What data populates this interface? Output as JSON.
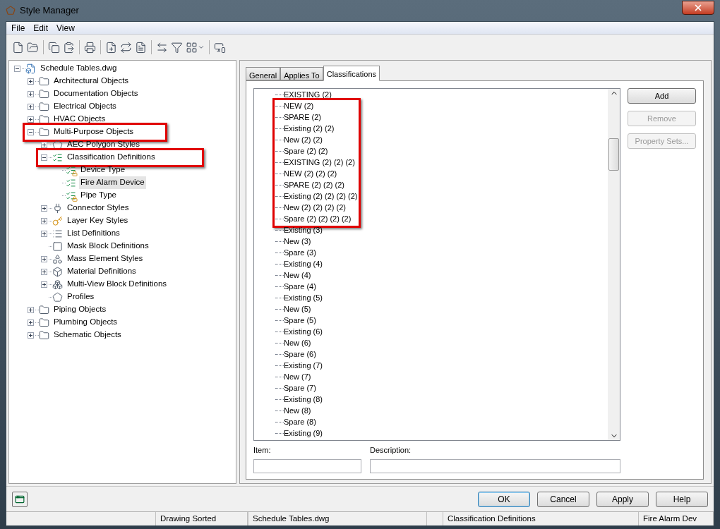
{
  "window": {
    "title": "Style Manager"
  },
  "menu": [
    "File",
    "Edit",
    "View"
  ],
  "toolbar": [
    {
      "kind": "new"
    },
    {
      "kind": "open"
    },
    {
      "kind": "sep"
    },
    {
      "kind": "copy"
    },
    {
      "kind": "paste"
    },
    {
      "kind": "sep"
    },
    {
      "kind": "print"
    },
    {
      "kind": "sep"
    },
    {
      "kind": "newstyle"
    },
    {
      "kind": "purge"
    },
    {
      "kind": "edit"
    },
    {
      "kind": "sep"
    },
    {
      "kind": "sync"
    },
    {
      "kind": "filter"
    },
    {
      "kind": "view"
    },
    {
      "kind": "sep"
    },
    {
      "kind": "toggle"
    }
  ],
  "tree": [
    {
      "label": "Schedule Tables.dwg",
      "kind": "drawing",
      "expanded": true,
      "selected": false,
      "highlighted": false,
      "children": [
        {
          "label": "Architectural Objects",
          "kind": "folder",
          "expanded": false,
          "selected": false,
          "highlighted": false
        },
        {
          "label": "Documentation Objects",
          "kind": "folder",
          "expanded": false,
          "selected": false,
          "highlighted": false
        },
        {
          "label": "Electrical Objects",
          "kind": "folder",
          "expanded": false,
          "selected": false,
          "highlighted": false
        },
        {
          "label": "HVAC Objects",
          "kind": "folder",
          "expanded": false,
          "selected": false,
          "highlighted": false
        },
        {
          "label": "Multi-Purpose Objects",
          "kind": "folder",
          "expanded": true,
          "selected": false,
          "highlighted": true,
          "children": [
            {
              "label": "AEC Polygon Styles",
              "kind": "polygon",
              "expanded": false,
              "selected": false,
              "highlighted": false
            },
            {
              "label": "Classification Definitions",
              "kind": "classification",
              "expanded": true,
              "selected": false,
              "highlighted": true,
              "children": [
                {
                  "label": "Device Type",
                  "kind": "classlock",
                  "selected": false,
                  "highlighted": false
                },
                {
                  "label": "Fire Alarm Device",
                  "kind": "classification",
                  "selected": true,
                  "highlighted": false
                },
                {
                  "label": "Pipe Type",
                  "kind": "classlock",
                  "selected": false,
                  "highlighted": false
                }
              ]
            },
            {
              "label": "Connector Styles",
              "kind": "connector",
              "expanded": false,
              "selected": false,
              "highlighted": false
            },
            {
              "label": "Layer Key Styles",
              "kind": "key",
              "expanded": false,
              "selected": false,
              "highlighted": false
            },
            {
              "label": "List Definitions",
              "kind": "list",
              "expanded": false,
              "selected": false,
              "highlighted": false
            },
            {
              "label": "Mask Block Definitions",
              "kind": "mask",
              "selected": false,
              "highlighted": false
            },
            {
              "label": "Mass Element Styles",
              "kind": "mass",
              "expanded": false,
              "selected": false,
              "highlighted": false
            },
            {
              "label": "Material Definitions",
              "kind": "material",
              "expanded": false,
              "selected": false,
              "highlighted": false
            },
            {
              "label": "Multi-View Block Definitions",
              "kind": "mvblock",
              "expanded": false,
              "selected": false,
              "highlighted": false
            },
            {
              "label": "Profiles",
              "kind": "profile",
              "selected": false,
              "highlighted": false
            }
          ]
        },
        {
          "label": "Piping Objects",
          "kind": "folder",
          "expanded": false,
          "selected": false,
          "highlighted": false
        },
        {
          "label": "Plumbing Objects",
          "kind": "folder",
          "expanded": false,
          "selected": false,
          "highlighted": false
        },
        {
          "label": "Schematic Objects",
          "kind": "folder",
          "expanded": false,
          "selected": false,
          "highlighted": false
        }
      ]
    }
  ],
  "tabs": [
    {
      "label": "General",
      "selected": false
    },
    {
      "label": "Applies To",
      "selected": false
    },
    {
      "label": "Classifications",
      "selected": true
    }
  ],
  "classifications": [
    {
      "highlighted": false,
      "items": [
        "EXISTING (2)"
      ]
    },
    {
      "highlighted": true,
      "items": [
        "NEW (2)",
        "SPARE (2)",
        "Existing (2) (2)",
        "New (2) (2)",
        "Spare (2) (2)",
        "EXISTING (2) (2) (2)",
        "NEW (2) (2) (2)",
        "SPARE (2) (2) (2)",
        "Existing (2) (2) (2) (2)",
        "New (2) (2) (2) (2)",
        "Spare (2) (2) (2) (2)"
      ]
    },
    {
      "highlighted": false,
      "items": [
        "Existing (3)",
        "New (3)",
        "Spare (3)",
        "Existing (4)",
        "New (4)",
        "Spare (4)",
        "Existing (5)",
        "New (5)",
        "Spare (5)",
        "Existing (6)",
        "New (6)",
        "Spare (6)",
        "Existing (7)",
        "New (7)",
        "Spare (7)",
        "Existing (8)",
        "New (8)",
        "Spare (8)",
        "Existing (9)"
      ]
    }
  ],
  "side_buttons": [
    {
      "label": "Add",
      "disabled": false
    },
    {
      "label": "Remove",
      "disabled": true
    },
    {
      "label": "Property Sets...",
      "disabled": true
    }
  ],
  "fields": [
    {
      "label": "Item:"
    },
    {
      "label": "Description:"
    }
  ],
  "dialog_buttons": [
    {
      "label": "OK",
      "default": true
    },
    {
      "label": "Cancel",
      "default": false
    },
    {
      "label": "Apply",
      "default": false
    },
    {
      "label": "Help",
      "default": false
    }
  ],
  "status_bar": [
    "Drawing Sorted",
    "Schedule Tables.dwg",
    "Classification Definitions",
    "Fire Alarm Dev"
  ]
}
